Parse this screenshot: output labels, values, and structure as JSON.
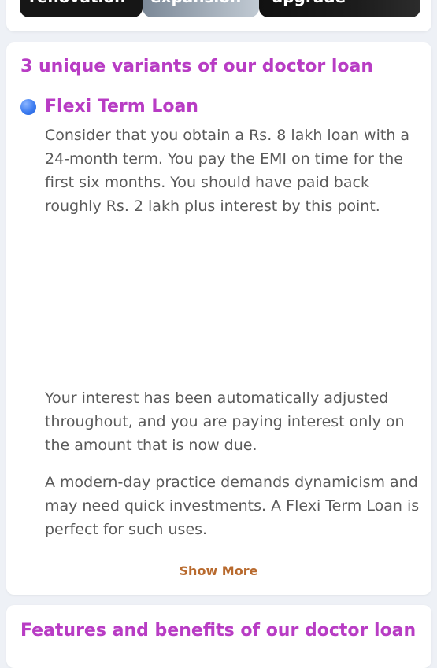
{
  "top_tiles": [
    {
      "label": "renovation"
    },
    {
      "label": "expansion"
    },
    {
      "label": "upgrade"
    }
  ],
  "variants_section": {
    "title": "3 unique variants of our doctor loan",
    "variant": {
      "icon": "blue-dot-icon",
      "title": "Flexi Term Loan",
      "paragraphs": [
        "Consider that you obtain a Rs. 8 lakh loan with a 24-month term. You pay the EMI on time for the first six months. You should have paid back roughly Rs. 2 lakh plus interest by this point.",
        "Your interest has been automatically adjusted throughout, and you are paying interest only on the amount that is now due.",
        "A modern-day practice demands dynamicism and may need quick investments. A Flexi Term Loan is perfect for such uses."
      ]
    },
    "show_more_label": "Show More"
  },
  "features_section": {
    "title": "Features and benefits of our doctor loan"
  },
  "colors": {
    "heading": "#b83cc4",
    "body_text": "#5a5a5a",
    "show_more": "#b86a2e",
    "dot": "#3d7cf0"
  }
}
